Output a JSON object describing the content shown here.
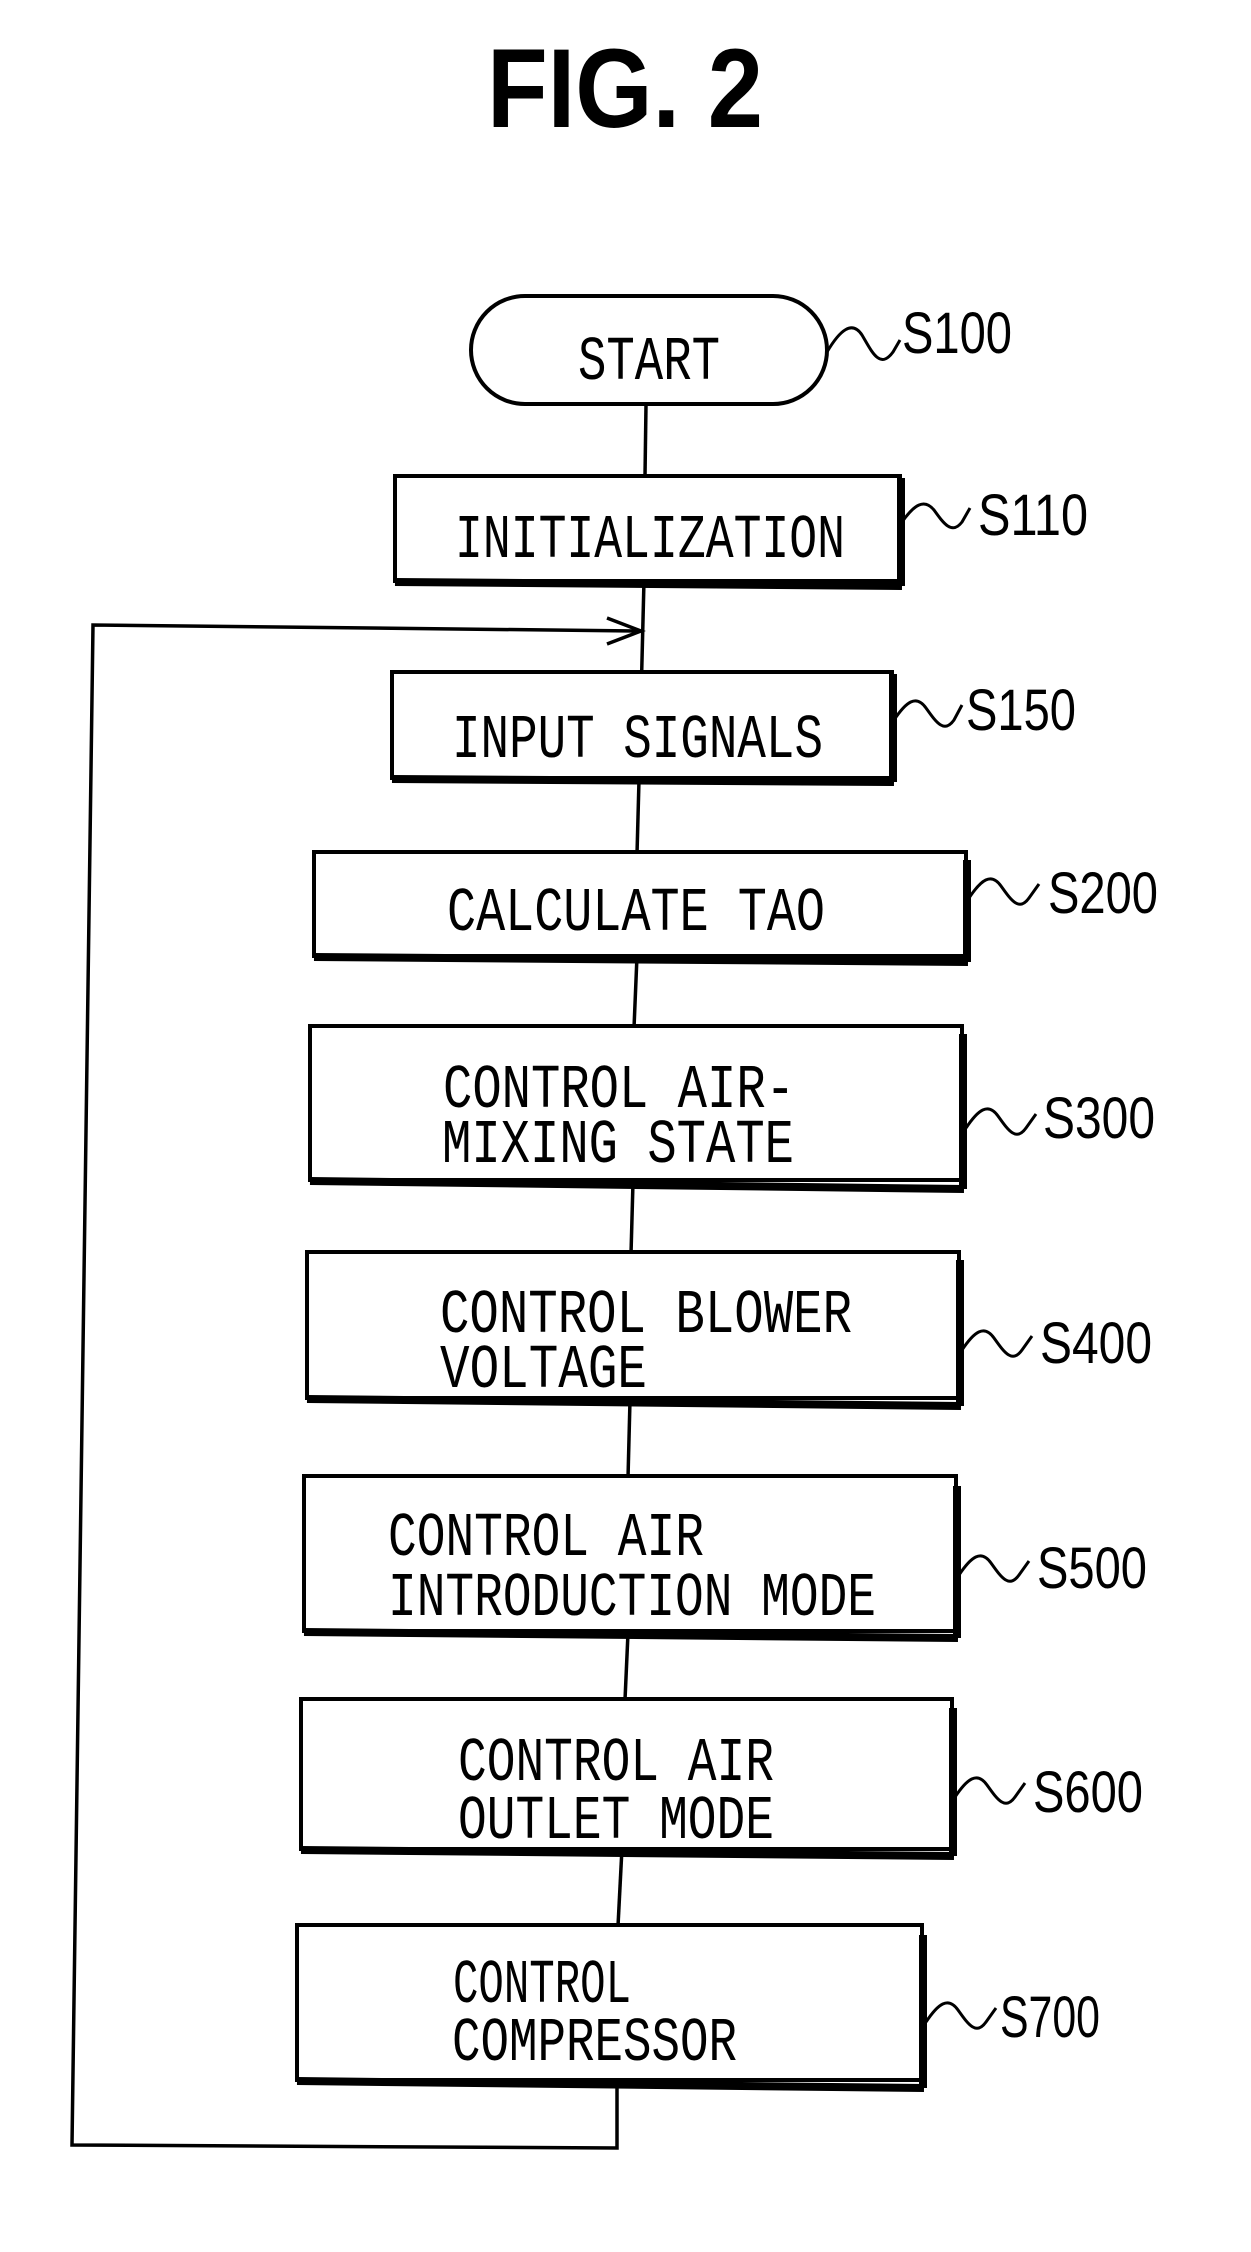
{
  "figure": {
    "title": "FIG. 2"
  },
  "flowchart": {
    "start": {
      "label": "START",
      "ref": "S100"
    },
    "steps": [
      {
        "ref": "S110",
        "lines": [
          "INITIALIZATION"
        ]
      },
      {
        "ref": "S150",
        "lines": [
          "INPUT SIGNALS"
        ]
      },
      {
        "ref": "S200",
        "lines": [
          "CALCULATE TAO"
        ]
      },
      {
        "ref": "S300",
        "lines": [
          "CONTROL AIR-",
          "MIXING STATE"
        ]
      },
      {
        "ref": "S400",
        "lines": [
          "CONTROL BLOWER",
          "VOLTAGE"
        ]
      },
      {
        "ref": "S500",
        "lines": [
          "CONTROL AIR",
          "INTRODUCTION MODE"
        ]
      },
      {
        "ref": "S600",
        "lines": [
          "CONTROL AIR",
          "OUTLET MODE"
        ]
      },
      {
        "ref": "S700",
        "lines": [
          "CONTROL",
          "COMPRESSOR"
        ]
      }
    ],
    "loop": {
      "from": "S700",
      "to": "S150",
      "description": "return arrow from after S700 back to before S150"
    }
  }
}
